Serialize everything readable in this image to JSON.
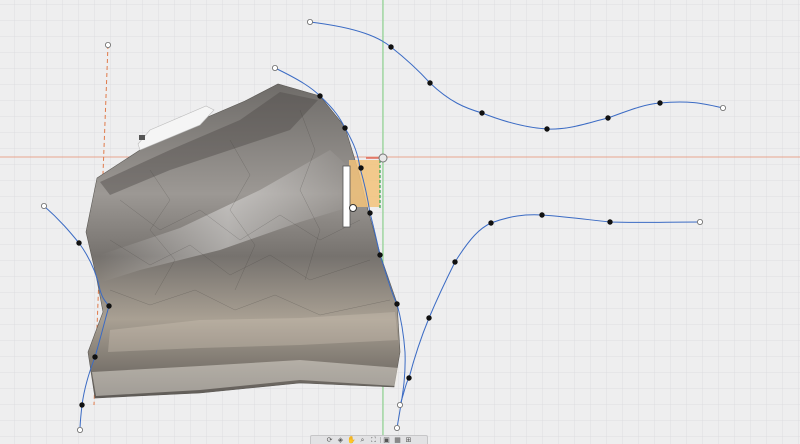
{
  "viewport": {
    "background": "#eeeeef",
    "grid_minor_color": "#dddde0",
    "grid_major_color": "#cfcfd3",
    "axis_x_color": "#e8a58f",
    "axis_y_color": "#7fd17f",
    "axis_z_color": "#e07a4a",
    "curve_color": "#3b6bc4",
    "point_color": "#111111",
    "mesh_color": "#8a8783"
  },
  "manipulator": {
    "handle_color": "#f2c27a",
    "slider_color": "#ffffff"
  },
  "nav_toolbar": {
    "tools": [
      {
        "icon": "orbit-icon",
        "glyph": "⟳"
      },
      {
        "icon": "look-at-icon",
        "glyph": "◈"
      },
      {
        "icon": "pan-icon",
        "glyph": "✋"
      },
      {
        "icon": "zoom-icon",
        "glyph": "⌕"
      },
      {
        "icon": "fit-icon",
        "glyph": "⛶"
      },
      {
        "icon": "display-settings-icon",
        "glyph": "▣"
      },
      {
        "icon": "grid-settings-icon",
        "glyph": "▦"
      },
      {
        "icon": "viewports-icon",
        "glyph": "⊞"
      }
    ]
  }
}
